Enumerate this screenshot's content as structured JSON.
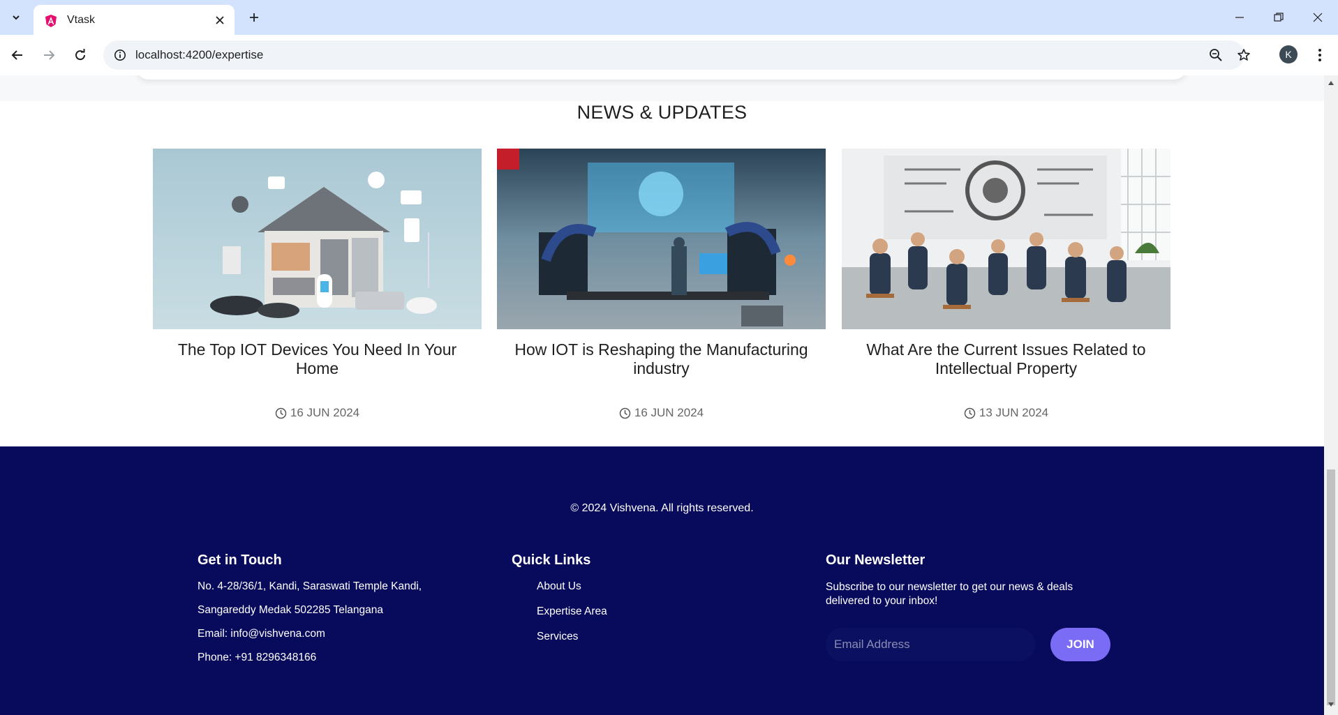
{
  "browser": {
    "tab_title": "Vtask",
    "url": "localhost:4200/expertise",
    "profile_initial": "K"
  },
  "news": {
    "heading": "NEWS & UPDATES",
    "cards": [
      {
        "title": "The Top IOT Devices You Need In Your Home",
        "date": "16 JUN 2024"
      },
      {
        "title": "How IOT is Reshaping the Manufacturing industry",
        "date": "16 JUN 2024"
      },
      {
        "title": "What Are the Current Issues Related to Intellectual Property",
        "date": "13 JUN 2024"
      }
    ]
  },
  "footer": {
    "copyright": "© 2024 Vishvena. All rights reserved.",
    "get_in_touch": {
      "heading": "Get in Touch",
      "address_line1": "No. 4-28/36/1, Kandi, Saraswati Temple Kandi,",
      "address_line2": "Sangareddy Medak 502285 Telangana",
      "email": "Email: info@vishvena.com",
      "phone": "Phone: +91 8296348166"
    },
    "quick_links": {
      "heading": "Quick Links",
      "items": [
        "About Us",
        "Expertise Area",
        "Services"
      ]
    },
    "newsletter": {
      "heading": "Our Newsletter",
      "text": "Subscribe to our newsletter to get our news & deals delivered to your inbox!",
      "email_placeholder": "Email Address",
      "join_label": "JOIN"
    }
  },
  "colors": {
    "tabbar": "#d3e3fd",
    "footer_bg": "#080b5c",
    "join_button": "#7a6cf5"
  }
}
